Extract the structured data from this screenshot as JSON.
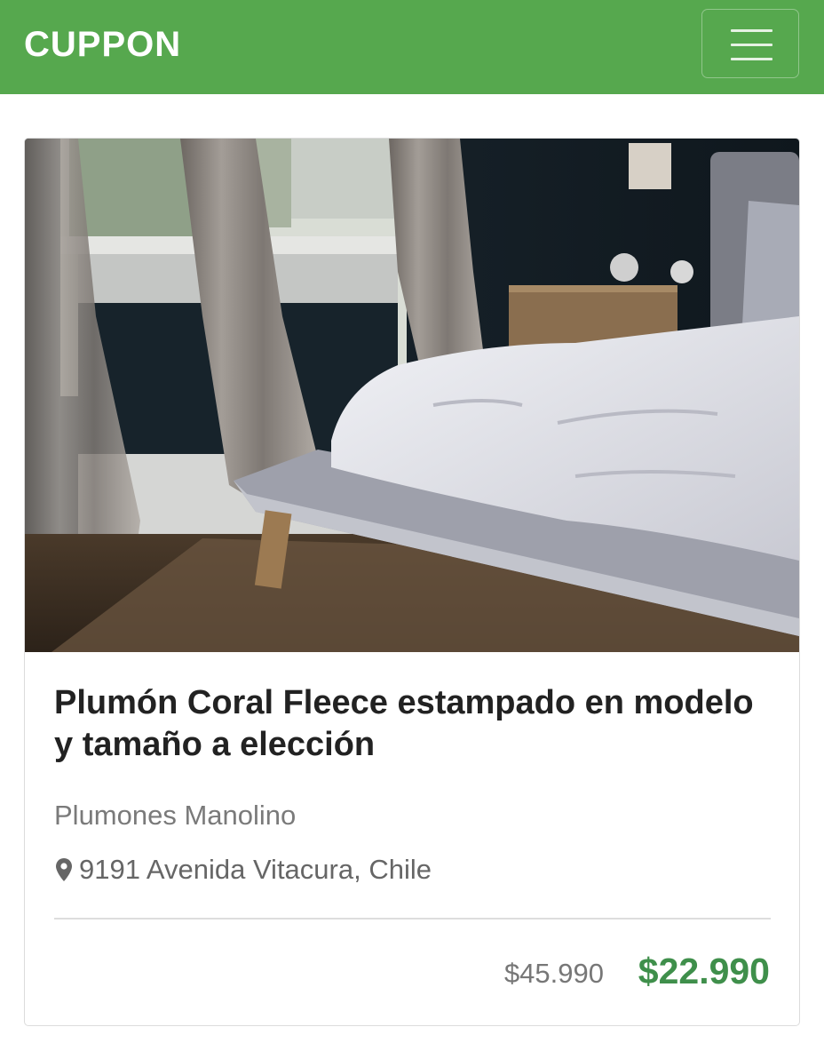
{
  "header": {
    "brand": "CUPPON",
    "menu_icon": "hamburger-menu-icon",
    "accent_color": "#56a84e"
  },
  "deal": {
    "image_description_icon": "bedroom-photo",
    "title": "Plumón Coral Fleece estampado en modelo y tamaño a elección",
    "merchant": "Plumones Manolino",
    "location_icon": "map-marker-icon",
    "address": "9191 Avenida Vitacura, Chile",
    "original_price": "$45.990",
    "discount_price": "$22.990",
    "price_color": "#3f8f4b"
  }
}
